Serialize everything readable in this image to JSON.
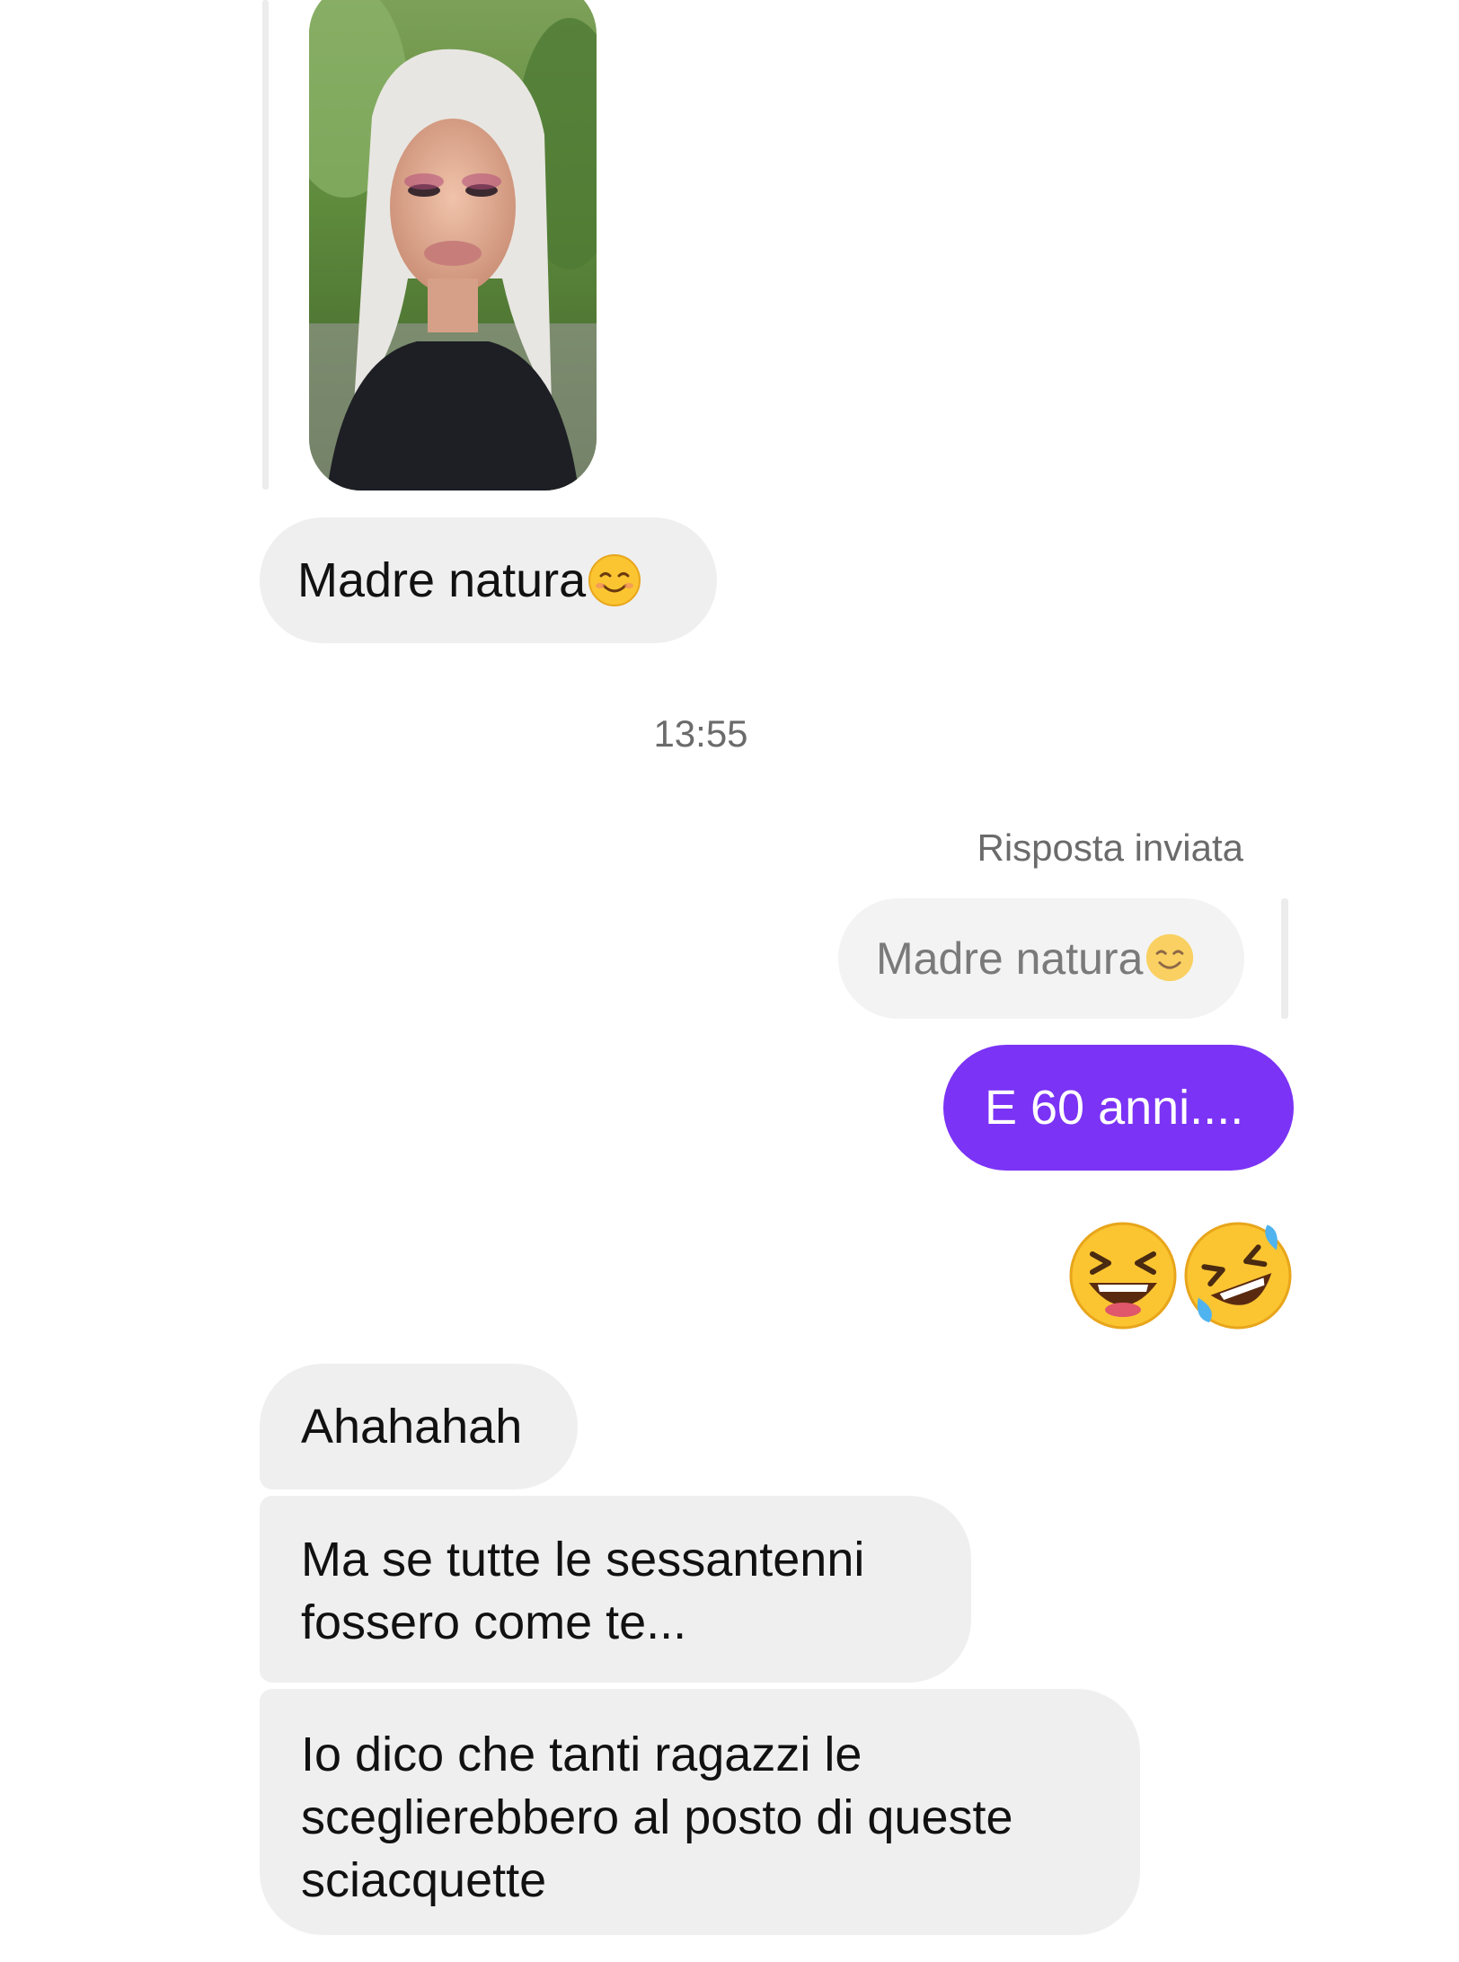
{
  "conversation": {
    "messages": [
      {
        "from": "them",
        "type": "photo",
        "alt": "selfie"
      },
      {
        "from": "them",
        "type": "text",
        "text": "Madre natura",
        "emoji": "smiling-face-icon"
      },
      {
        "from": "system",
        "type": "timestamp",
        "text": "13:55"
      },
      {
        "from": "me",
        "type": "reply-label",
        "text": "Risposta inviata"
      },
      {
        "from": "me",
        "type": "quoted",
        "text": "Madre natura",
        "emoji": "smiling-face-icon"
      },
      {
        "from": "me",
        "type": "text",
        "text": "E 60 anni...."
      },
      {
        "from": "me",
        "type": "emoji",
        "emojis": [
          "grinning-squinting-face-icon",
          "rolling-on-floor-laughing-icon"
        ]
      },
      {
        "from": "them",
        "type": "text",
        "text": "Ahahahah"
      },
      {
        "from": "them",
        "type": "text",
        "lines": [
          "Ma se tutte le sessantenni",
          "fossero come te..."
        ]
      },
      {
        "from": "them",
        "type": "text",
        "lines": [
          "Io dico che tanti ragazzi le",
          "sceglierebbero al posto di queste",
          "sciacquette"
        ]
      }
    ]
  },
  "colors": {
    "outgoing_bubble": "#7b33f5",
    "incoming_bubble": "#efefef",
    "meta_text": "#6b6b6b"
  }
}
